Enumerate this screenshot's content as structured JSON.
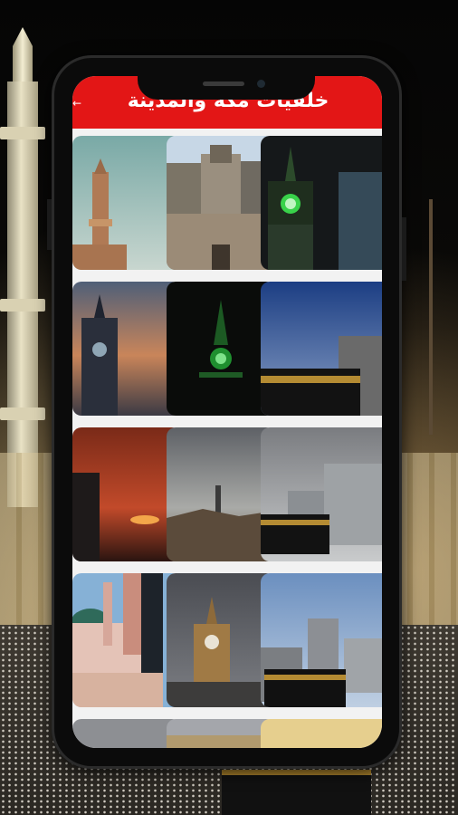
{
  "app": {
    "title": "خلفيات مكة والمدينة"
  },
  "colors": {
    "app_bar": "#e31616",
    "screen_bg": "#f2f2f2",
    "phone_frame": "#0b0b0b"
  },
  "icons": {
    "back": "arrow-back-icon"
  },
  "gallery": {
    "thumbnails": [
      {
        "subject": "mosque-minaret-teal-sky"
      },
      {
        "subject": "clock-tower-complex-daylight"
      },
      {
        "subject": "clock-tower-green-glow-night"
      },
      {
        "subject": "clock-tower-sunset-clouds"
      },
      {
        "subject": "clock-tower-green-lights-dark"
      },
      {
        "subject": "kaaba-blue-cloudy-sky"
      },
      {
        "subject": "clock-tower-orange-dusk"
      },
      {
        "subject": "city-grey-sky-rocks"
      },
      {
        "subject": "kaaba-cloudy-towers"
      },
      {
        "subject": "prophets-mosque-green-dome"
      },
      {
        "subject": "clock-tower-grey-sky"
      },
      {
        "subject": "kaaba-blue-sky-towers"
      },
      {
        "subject": "partial-thumbnail-1"
      },
      {
        "subject": "partial-thumbnail-2"
      },
      {
        "subject": "partial-thumbnail-3"
      }
    ]
  }
}
